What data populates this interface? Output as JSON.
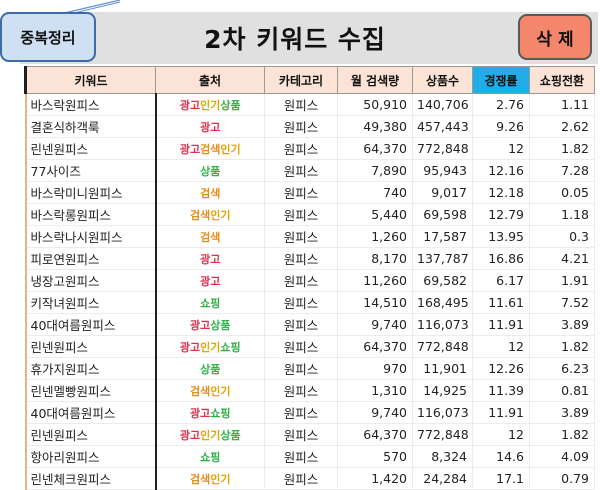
{
  "toolbar": {
    "dedupe_label": "중복정리",
    "title": "2차 키워드 수집",
    "delete_label": "삭 제"
  },
  "columns": [
    "키워드",
    "출처",
    "카테고리",
    "월 검색량",
    "상품수",
    "경쟁률",
    "쇼핑전환"
  ],
  "source_colors": {
    "광고": "#e0304e",
    "인기": "#dea800",
    "상품": "#2fb64a",
    "검색": "#e88d1a",
    "쇼핑": "#2cae43"
  },
  "rows": [
    {
      "keyword": "바스락원피스",
      "source": [
        "광고",
        "인기",
        "상품"
      ],
      "category": "원피스",
      "volume": "50,910",
      "products": "140,706",
      "competition": "2.76",
      "conversion": "1.11"
    },
    {
      "keyword": "결혼식하객룩",
      "source": [
        "광고"
      ],
      "category": "원피스",
      "volume": "49,380",
      "products": "457,443",
      "competition": "9.26",
      "conversion": "2.62"
    },
    {
      "keyword": "린넨원피스",
      "source": [
        "광고",
        "검색",
        "인기"
      ],
      "category": "원피스",
      "volume": "64,370",
      "products": "772,848",
      "competition": "12",
      "conversion": "1.82"
    },
    {
      "keyword": "77사이즈",
      "source": [
        "상품"
      ],
      "category": "원피스",
      "volume": "7,890",
      "products": "95,943",
      "competition": "12.16",
      "conversion": "7.28"
    },
    {
      "keyword": "바스락미니원피스",
      "source": [
        "검색"
      ],
      "category": "원피스",
      "volume": "740",
      "products": "9,017",
      "competition": "12.18",
      "conversion": "0.05"
    },
    {
      "keyword": "바스락롱원피스",
      "source": [
        "검색",
        "인기"
      ],
      "category": "원피스",
      "volume": "5,440",
      "products": "69,598",
      "competition": "12.79",
      "conversion": "1.18"
    },
    {
      "keyword": "바스락나시원피스",
      "source": [
        "검색"
      ],
      "category": "원피스",
      "volume": "1,260",
      "products": "17,587",
      "competition": "13.95",
      "conversion": "0.3"
    },
    {
      "keyword": "피로연원피스",
      "source": [
        "광고"
      ],
      "category": "원피스",
      "volume": "8,170",
      "products": "137,787",
      "competition": "16.86",
      "conversion": "4.21"
    },
    {
      "keyword": "냉장고원피스",
      "source": [
        "광고"
      ],
      "category": "원피스",
      "volume": "11,260",
      "products": "69,582",
      "competition": "6.17",
      "conversion": "1.91"
    },
    {
      "keyword": "키작녀원피스",
      "source": [
        "쇼핑"
      ],
      "category": "원피스",
      "volume": "14,510",
      "products": "168,495",
      "competition": "11.61",
      "conversion": "7.52"
    },
    {
      "keyword": "40대여름원피스",
      "source": [
        "광고",
        "상품"
      ],
      "category": "원피스",
      "volume": "9,740",
      "products": "116,073",
      "competition": "11.91",
      "conversion": "3.89"
    },
    {
      "keyword": "린넨원피스",
      "source": [
        "광고",
        "인기",
        "쇼핑"
      ],
      "category": "원피스",
      "volume": "64,370",
      "products": "772,848",
      "competition": "12",
      "conversion": "1.82"
    },
    {
      "keyword": "휴가지원피스",
      "source": [
        "상품"
      ],
      "category": "원피스",
      "volume": "970",
      "products": "11,901",
      "competition": "12.26",
      "conversion": "6.23"
    },
    {
      "keyword": "린넨멜빵원피스",
      "source": [
        "검색",
        "인기"
      ],
      "category": "원피스",
      "volume": "1,310",
      "products": "14,925",
      "competition": "11.39",
      "conversion": "0.81"
    },
    {
      "keyword": "40대여름원피스",
      "source": [
        "광고",
        "쇼핑"
      ],
      "category": "원피스",
      "volume": "9,740",
      "products": "116,073",
      "competition": "11.91",
      "conversion": "3.89"
    },
    {
      "keyword": "린넨원피스",
      "source": [
        "광고",
        "인기",
        "상품"
      ],
      "category": "원피스",
      "volume": "64,370",
      "products": "772,848",
      "competition": "12",
      "conversion": "1.82"
    },
    {
      "keyword": "항아리원피스",
      "source": [
        "쇼핑"
      ],
      "category": "원피스",
      "volume": "570",
      "products": "8,324",
      "competition": "14.6",
      "conversion": "4.09"
    },
    {
      "keyword": "린넨체크원피스",
      "source": [
        "검색",
        "인기"
      ],
      "category": "원피스",
      "volume": "1,420",
      "products": "24,284",
      "competition": "17.1",
      "conversion": "0.79"
    }
  ]
}
